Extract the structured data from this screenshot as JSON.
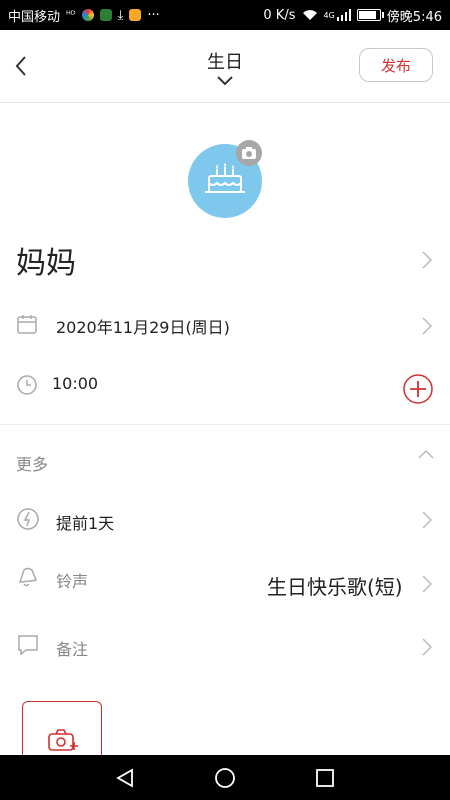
{
  "status_bar": {
    "carrier": "中国移动",
    "extra_icons": [
      "hd-icon",
      "app-icon-colorful",
      "app-icon-green",
      "download-icon",
      "app-icon-yellow"
    ],
    "more": "···",
    "speed": "0 K/s",
    "network": "4G",
    "time": "傍晚5:46"
  },
  "header": {
    "title": "生日",
    "publish_label": "发布"
  },
  "avatar": {
    "icon": "birthday-cake-icon",
    "badge_icon": "camera-icon",
    "color": "#7ec8ee"
  },
  "contact": {
    "name": "妈妈"
  },
  "date": {
    "value": "2020年11月29日(周日)"
  },
  "time": {
    "value": "10:00"
  },
  "more": {
    "label": "更多"
  },
  "reminder": {
    "value": "提前1天"
  },
  "ringtone": {
    "label": "铃声",
    "value": "生日快乐歌(短)"
  },
  "note": {
    "label": "备注"
  },
  "colors": {
    "accent": "#d32f2f",
    "avatar_bg": "#7ec8ee",
    "muted_text": "#888888"
  }
}
